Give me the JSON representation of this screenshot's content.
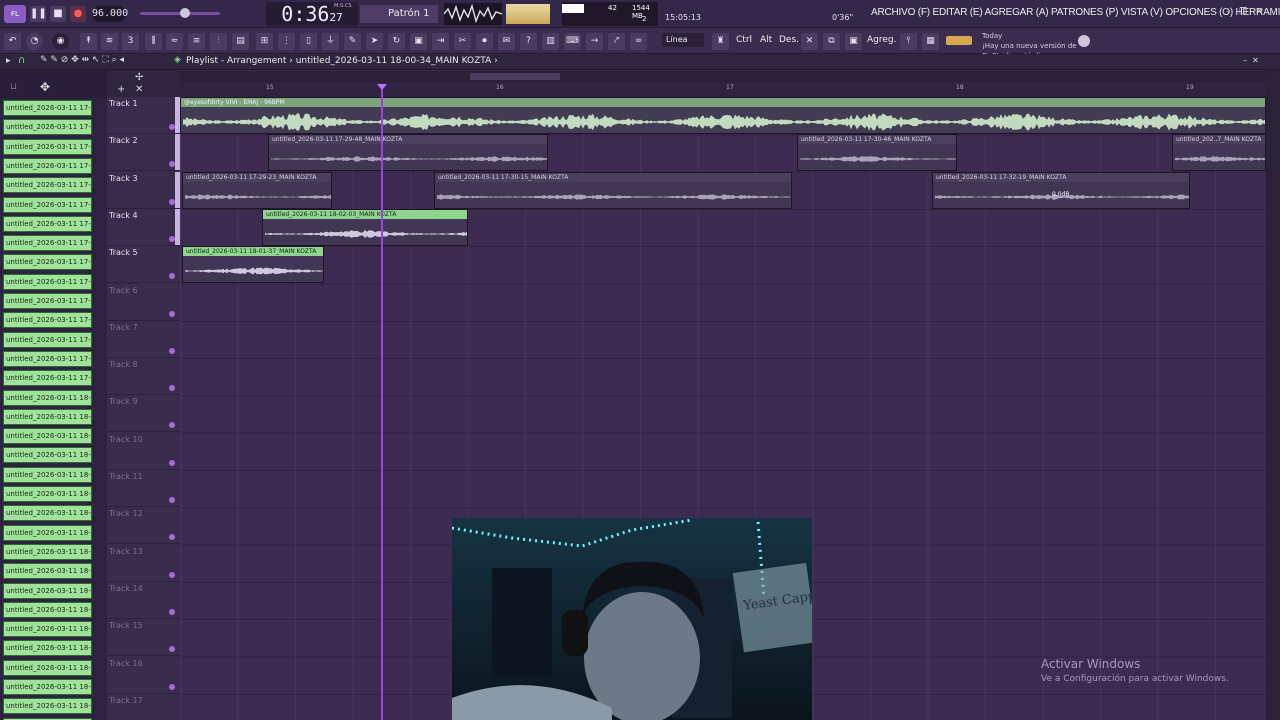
{
  "topbar": {
    "logo": "FL",
    "bpm": "96.000",
    "time": "0:36",
    "time_frac": "27",
    "time_unit": "M:S:CS",
    "pattern": "Patrón 1",
    "memory_value": "42",
    "memory": "1544 MB",
    "memory_sub": "2",
    "clock": "15:05:13",
    "cpu": "0'36\"",
    "menu": "ARCHIVO (F) EDITAR (E) AGREGAR (A) PATRONES (P) VISTA (V) OPCIONES (O) HERRAMIENTAS (T) AYUDA",
    "window_buttons": [
      "–",
      "❐",
      "✕"
    ]
  },
  "toolbar": {
    "snap": "Línea",
    "mod_keys": [
      "Ctrl",
      "Alt",
      "Des."
    ],
    "add_label": "Agreg.",
    "news_title": "Today",
    "news_text": "¡Hay una nueva versión de FL Studio está di.."
  },
  "playlist": {
    "title": "Playlist - Arrangement",
    "file": "untitled_2026-03-11 18-00-34_MAIN KOZTA",
    "bars": [
      "15",
      "16",
      "17",
      "18",
      "19"
    ]
  },
  "browser": {
    "items": [
      "untitled_2026-03-11 17-...",
      "untitled_2026-03-11 17-...",
      "untitled_2026-03-11 17-...",
      "untitled_2026-03-11 17-...",
      "untitled_2026-03-11 17-...",
      "untitled_2026-03-11 17-...",
      "untitled_2026-03-11 17-...",
      "untitled_2026-03-11 17-...",
      "untitled_2026-03-11 17-...",
      "untitled_2026-03-11 17-...",
      "untitled_2026-03-11 17-...",
      "untitled_2026-03-11 17-...",
      "untitled_2026-03-11 17-...",
      "untitled_2026-03-11 17-...",
      "untitled_2026-03-11 17-...",
      "untitled_2026-03-11 18-...",
      "untitled_2026-03-11 18-...",
      "untitled_2026-03-11 18-...",
      "untitled_2026-03-11 18-...",
      "untitled_2026-03-11 18-...",
      "untitled_2026-03-11 18-...",
      "untitled_2026-03-11 18-...",
      "untitled_2026-03-11 18-...",
      "untitled_2026-03-11 18-...",
      "untitled_2026-03-11 18-...",
      "untitled_2026-03-11 18-...",
      "untitled_2026-03-11 18-...",
      "untitled_2026-03-11 18-...",
      "untitled_2026-03-11 18-...",
      "untitled_2026-03-11 18-...",
      "untitled_2026-03-11 18-...",
      "untitled_2026-03-11 18-...",
      "untitled_2026-03-11 18-..."
    ]
  },
  "tracks": [
    "Track 1",
    "Track 2",
    "Track 3",
    "Track 4",
    "Track 5",
    "Track 6",
    "Track 7",
    "Track 8",
    "Track 9",
    "Track 10",
    "Track 11",
    "Track 12",
    "Track 13",
    "Track 14",
    "Track 15",
    "Track 16",
    "Track 17"
  ],
  "clips": [
    {
      "label": "@eyesofdirty VIVI - EMAJ - 96BPM",
      "style": "first"
    },
    {
      "label": "untitled_2026-03-11 17-29-48_MAIN KOZTA",
      "style": "gray"
    },
    {
      "label": "untitled_2026-03-11 17-30-46_MAIN KOZTA",
      "style": "gray"
    },
    {
      "label": "untitled_202..7_MAIN KOZTA",
      "style": "gray"
    },
    {
      "label": "untitled_2026-03-11 17-29-23_MAIN KOZTA",
      "style": "gray"
    },
    {
      "label": "untitled_2026-03-11 17-30-15_MAIN KOZTA",
      "style": "gray"
    },
    {
      "label": "untitled_2026-03-11 17-32-19_MAIN KOZTA",
      "style": "gray"
    },
    {
      "label": "untitled_2026-03-11 18-02-03_MAIN KOZTA",
      "style": "green"
    },
    {
      "label": "untitled_2026-03-11 18-01-37_MAIN KOZTA",
      "style": "green"
    }
  ],
  "gain_readout": "0.0dB",
  "watermark": {
    "title": "Activar Windows",
    "sub": "Ve a Configuración para activar Windows."
  },
  "webcam": {
    "poster": "Yeast Capp"
  },
  "colors": {
    "accent": "#a43fe8",
    "clip_green": "#8fd58f",
    "background": "#3d2b52"
  }
}
